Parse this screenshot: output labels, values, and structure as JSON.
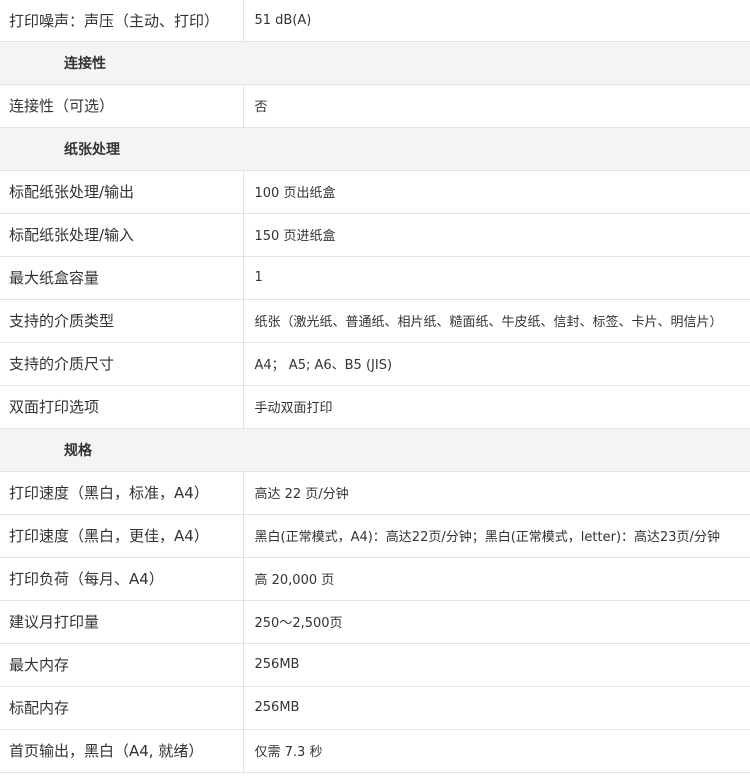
{
  "rows": [
    {
      "type": "spec",
      "label": "打印噪声：声压（主动、打印）",
      "value": "51 dB(A)"
    },
    {
      "type": "section",
      "title": "连接性"
    },
    {
      "type": "spec",
      "label": "连接性（可选）",
      "value": "否"
    },
    {
      "type": "section",
      "title": "纸张处理"
    },
    {
      "type": "spec",
      "label": "标配纸张处理/输出",
      "value": "100 页出纸盒"
    },
    {
      "type": "spec",
      "label": "标配纸张处理/输入",
      "value": "150 页进纸盒"
    },
    {
      "type": "spec",
      "label": "最大纸盒容量",
      "value": "1"
    },
    {
      "type": "spec",
      "label": "支持的介质类型",
      "value": "纸张（激光纸、普通纸、相片纸、糙面纸、牛皮纸、信封、标签、卡片、明信片）"
    },
    {
      "type": "spec",
      "label": "支持的介质尺寸",
      "value": "A4； A5; A6、B5 (JIS)"
    },
    {
      "type": "spec",
      "label": "双面打印选项",
      "value": "手动双面打印"
    },
    {
      "type": "section",
      "title": "规格"
    },
    {
      "type": "spec",
      "label": "打印速度（黑白，标准，A4）",
      "value": "高达 22 页/分钟"
    },
    {
      "type": "spec",
      "label": "打印速度（黑白，更佳，A4）",
      "value": "黑白(正常模式，A4)：高达22页/分钟；黑白(正常模式，letter)：高达23页/分钟"
    },
    {
      "type": "spec",
      "label": "打印负荷（每月、A4）",
      "value": "高 20,000 页"
    },
    {
      "type": "spec",
      "label": "建议月打印量",
      "value": "250～2,500页"
    },
    {
      "type": "spec",
      "label": "最大内存",
      "value": "256MB"
    },
    {
      "type": "spec",
      "label": "标配内存",
      "value": "256MB"
    },
    {
      "type": "spec",
      "label": "首页输出，黑白（A4, 就绪）",
      "value": "仅需 7.3 秒"
    }
  ]
}
